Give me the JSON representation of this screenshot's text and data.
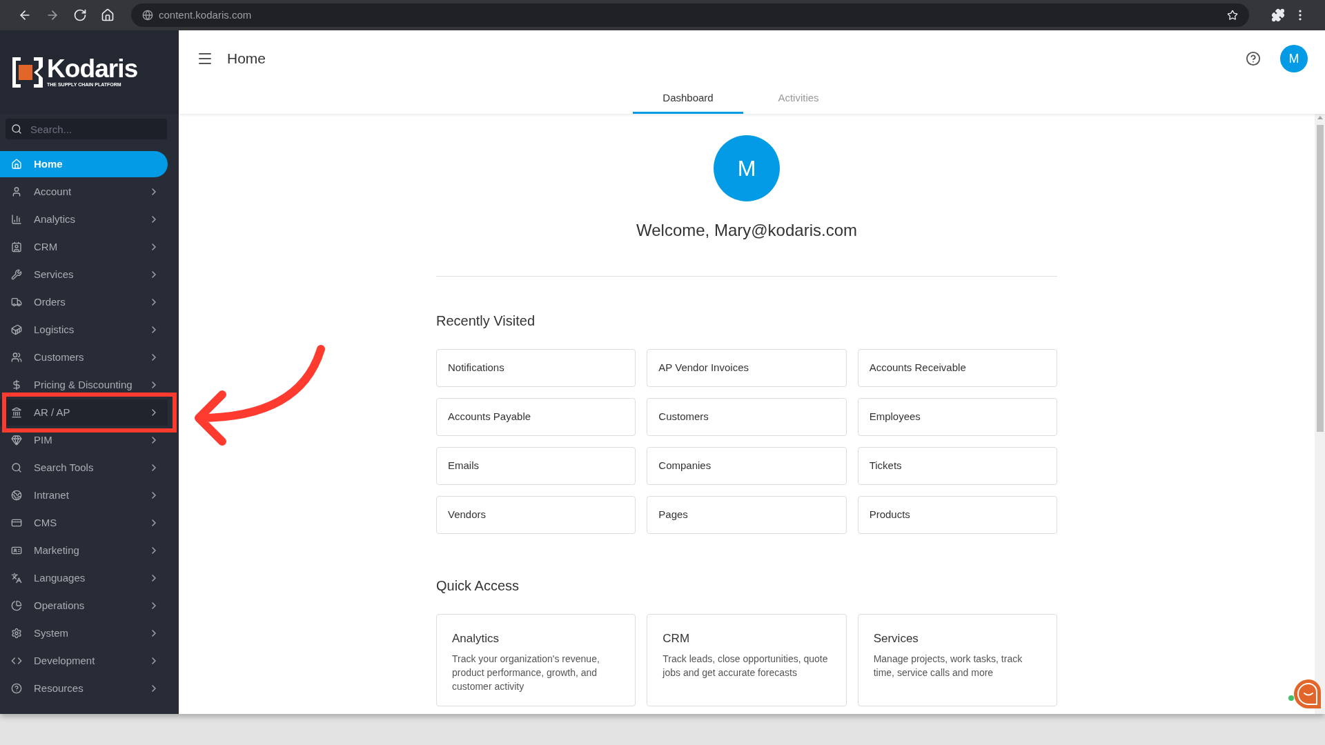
{
  "browser": {
    "url": "content.kodaris.com"
  },
  "sidebar": {
    "brand": "Kodaris",
    "tagline": "THE SUPPLY CHAIN PLATFORM",
    "search": {
      "placeholder": "Search..."
    },
    "items": [
      {
        "label": "Home",
        "selected": true,
        "has_submenu": false,
        "highlighted": false
      },
      {
        "label": "Account",
        "selected": false,
        "has_submenu": true,
        "highlighted": false
      },
      {
        "label": "Analytics",
        "selected": false,
        "has_submenu": true,
        "highlighted": false
      },
      {
        "label": "CRM",
        "selected": false,
        "has_submenu": true,
        "highlighted": false
      },
      {
        "label": "Services",
        "selected": false,
        "has_submenu": true,
        "highlighted": false
      },
      {
        "label": "Orders",
        "selected": false,
        "has_submenu": true,
        "highlighted": false
      },
      {
        "label": "Logistics",
        "selected": false,
        "has_submenu": true,
        "highlighted": false
      },
      {
        "label": "Customers",
        "selected": false,
        "has_submenu": true,
        "highlighted": false
      },
      {
        "label": "Pricing & Discounting",
        "selected": false,
        "has_submenu": true,
        "highlighted": false
      },
      {
        "label": "AR / AP",
        "selected": false,
        "has_submenu": true,
        "highlighted": true
      },
      {
        "label": "PIM",
        "selected": false,
        "has_submenu": true,
        "highlighted": false
      },
      {
        "label": "Search Tools",
        "selected": false,
        "has_submenu": true,
        "highlighted": false
      },
      {
        "label": "Intranet",
        "selected": false,
        "has_submenu": true,
        "highlighted": false
      },
      {
        "label": "CMS",
        "selected": false,
        "has_submenu": true,
        "highlighted": false
      },
      {
        "label": "Marketing",
        "selected": false,
        "has_submenu": true,
        "highlighted": false
      },
      {
        "label": "Languages",
        "selected": false,
        "has_submenu": true,
        "highlighted": false
      },
      {
        "label": "Operations",
        "selected": false,
        "has_submenu": true,
        "highlighted": false
      },
      {
        "label": "System",
        "selected": false,
        "has_submenu": true,
        "highlighted": false
      },
      {
        "label": "Development",
        "selected": false,
        "has_submenu": true,
        "highlighted": false
      },
      {
        "label": "Resources",
        "selected": false,
        "has_submenu": true,
        "highlighted": false
      }
    ]
  },
  "header": {
    "title": "Home",
    "avatar": "M"
  },
  "tabs": [
    {
      "label": "Dashboard",
      "selected": true
    },
    {
      "label": "Activities",
      "selected": false
    }
  ],
  "profile": {
    "avatar": "M",
    "welcome": "Welcome, Mary@kodaris.com"
  },
  "recently_visited": {
    "title": "Recently Visited",
    "items": [
      "Notifications",
      "AP Vendor Invoices",
      "Accounts Receivable",
      "Accounts Payable",
      "Customers",
      "Employees",
      "Emails",
      "Companies",
      "Tickets",
      "Vendors",
      "Pages",
      "Products"
    ]
  },
  "quick_access": {
    "title": "Quick Access",
    "cards": [
      {
        "title": "Analytics",
        "description": "Track your organization's revenue, product performance, growth, and customer activity"
      },
      {
        "title": "CRM",
        "description": "Track leads, close opportunities, quote jobs and get accurate forecasts"
      },
      {
        "title": "Services",
        "description": "Manage projects, work tasks, track time, service calls and more"
      }
    ]
  }
}
